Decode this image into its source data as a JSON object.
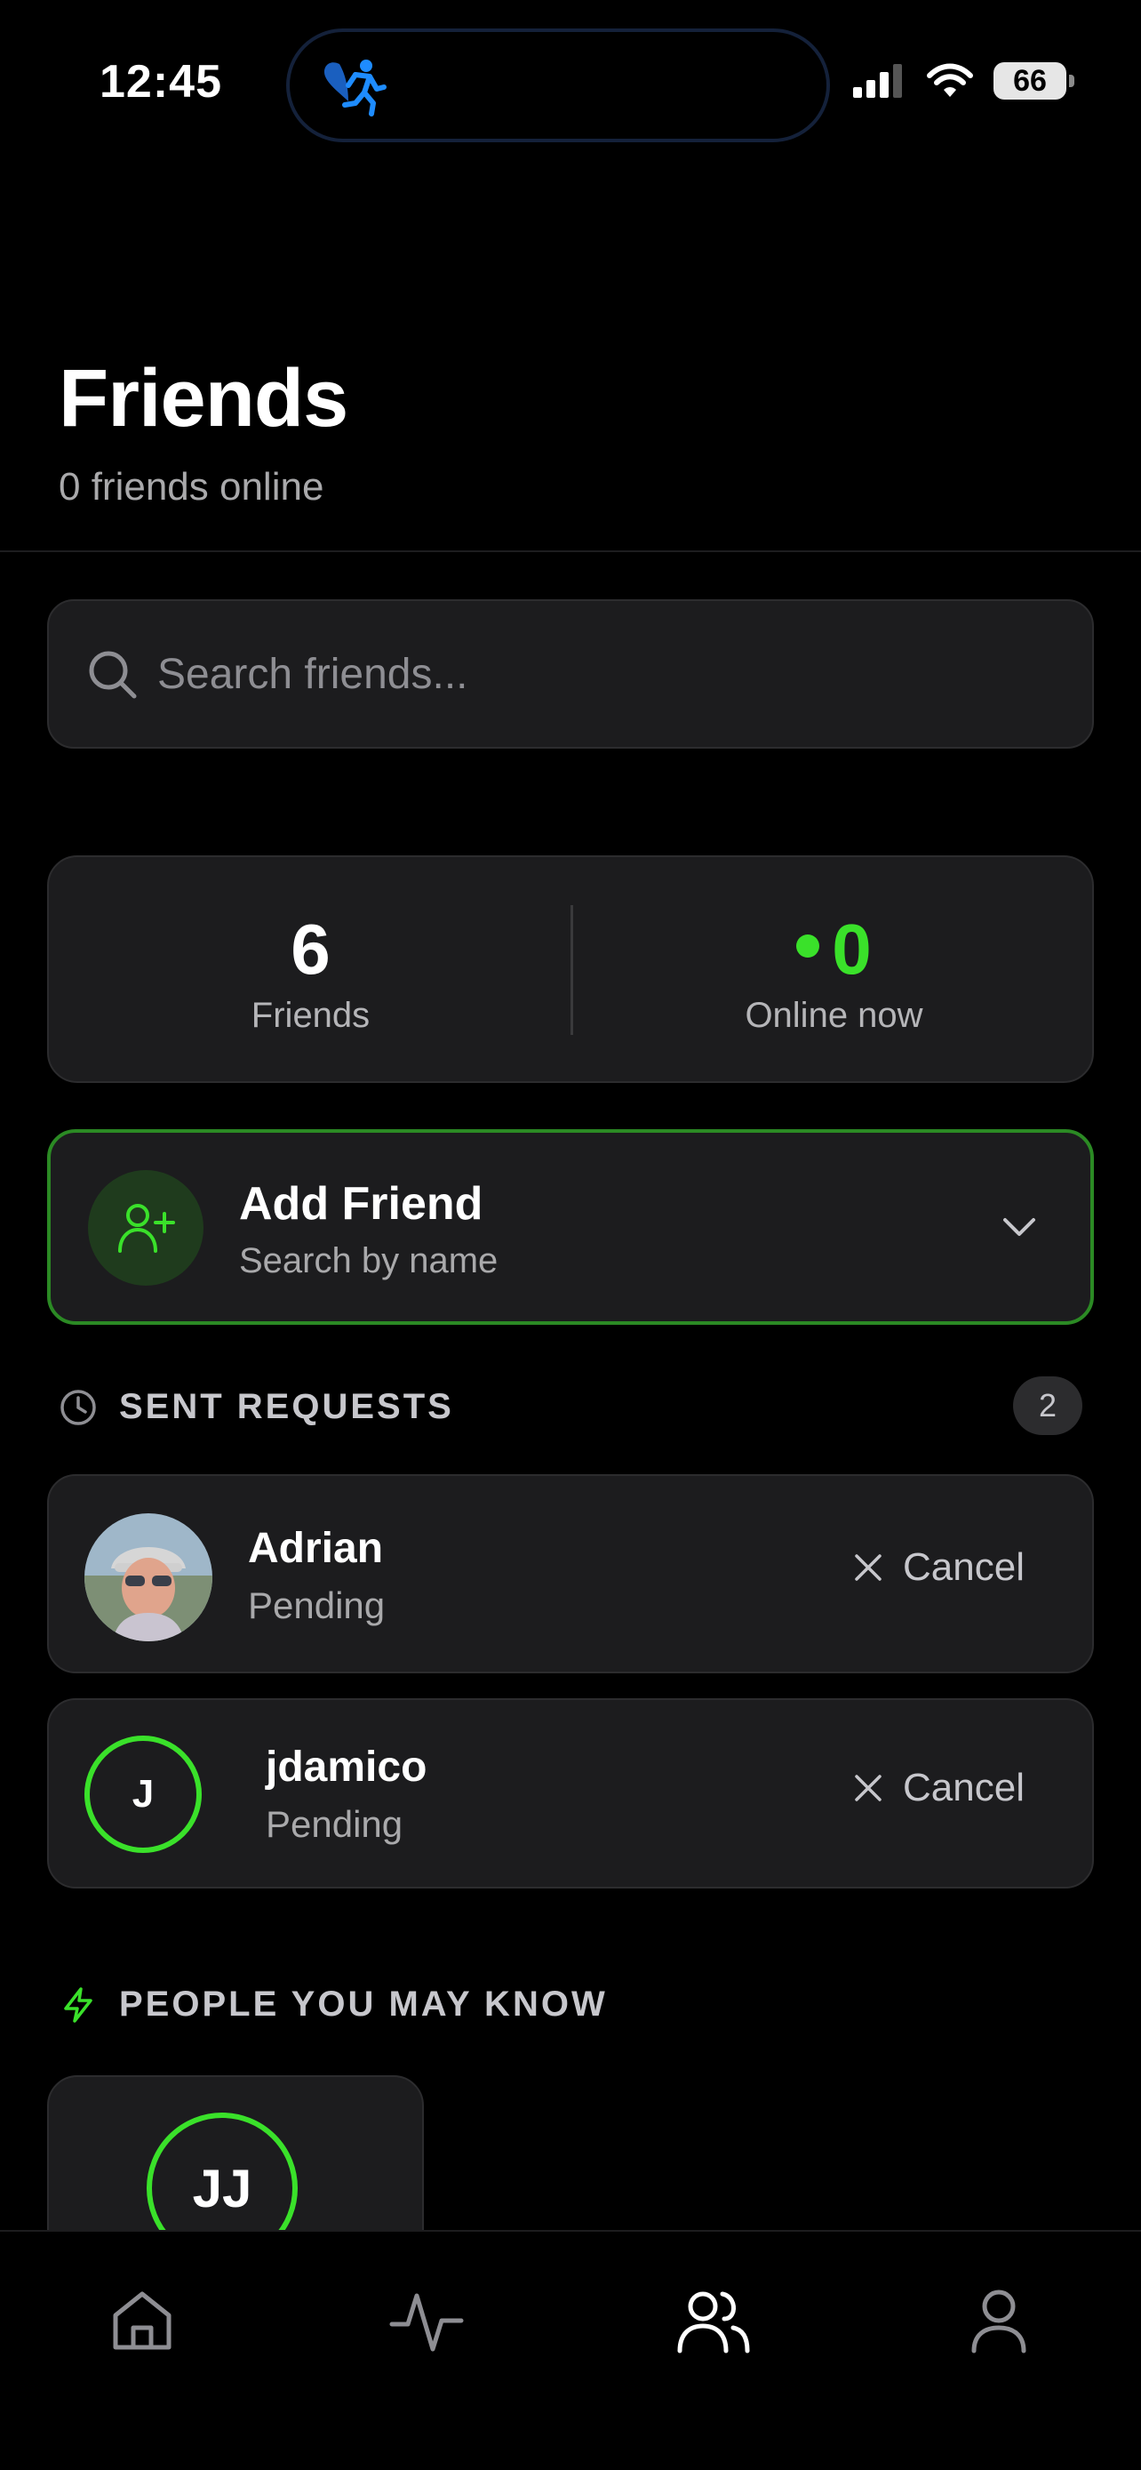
{
  "status_bar": {
    "time": "12:45",
    "battery": "66",
    "icons": [
      "heart-runner-icon",
      "cellular-signal-icon",
      "wifi-icon",
      "battery-icon"
    ]
  },
  "header": {
    "title": "Friends",
    "subtitle": "0 friends online"
  },
  "search": {
    "placeholder": "Search friends...",
    "value": ""
  },
  "stats": {
    "friends_count": "6",
    "friends_label": "Friends",
    "online_count": "0",
    "online_label": "Online now"
  },
  "add_friend": {
    "title": "Add Friend",
    "subtitle": "Search by name"
  },
  "sent_requests": {
    "heading": "SENT REQUESTS",
    "count": "2",
    "items": [
      {
        "name": "Adrian",
        "status": "Pending",
        "action": "Cancel"
      },
      {
        "name": "jdamico",
        "initial": "J",
        "status": "Pending",
        "action": "Cancel"
      }
    ]
  },
  "suggestions": {
    "heading": "PEOPLE YOU MAY KNOW",
    "items": [
      {
        "initials": "JJ"
      }
    ]
  },
  "tab_bar": {
    "tabs": [
      "home-icon",
      "activity-icon",
      "friends-icon",
      "profile-icon"
    ],
    "active": "friends-icon"
  },
  "colors": {
    "accent": "#3ae12a",
    "card": "#1c1c1e",
    "background": "#000000",
    "island_icon": "#1e6fd9"
  }
}
